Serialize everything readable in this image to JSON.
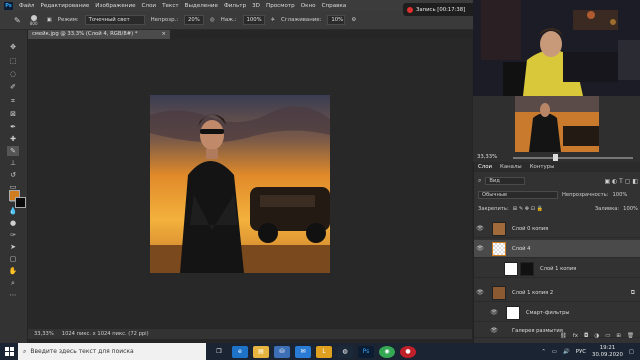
{
  "app": {
    "logo_text": "Ps"
  },
  "menubar": {
    "items": [
      "Файл",
      "Редактирование",
      "Изображение",
      "Слои",
      "Текст",
      "Выделение",
      "Фильтр",
      "3D",
      "Просмотр",
      "Окно",
      "Справка"
    ]
  },
  "options_bar": {
    "brush_size": "800",
    "mode_label": "Режим:",
    "mode_value": "Точечный свет",
    "opacity_label": "Непрозр.:",
    "opacity_value": "20%",
    "flow_label": "Наж.:",
    "flow_value": "100%",
    "smoothing_label": "Сглаживание:",
    "smoothing_value": "10%"
  },
  "recording": {
    "text": "Запись [00:17:38]"
  },
  "document": {
    "tab_title": "смейк.jpg @ 33,3% (Слой 4, RGB/8#) *",
    "close_symbol": "×",
    "status_zoom": "33,33%",
    "status_info": "1024 пикс. x 1024 пикс. (72 ppi)"
  },
  "colors": {
    "foreground": "#d07d1f",
    "background": "#0b0b0b",
    "accent": "#31a8ff"
  },
  "navigator": {
    "zoom": "33,33%"
  },
  "layers_panel": {
    "tabs": [
      "Слои",
      "Каналы",
      "Контуры"
    ],
    "active_tab": "Слои",
    "filter_label": "Вид",
    "blend_mode": "Обычные",
    "opacity_label": "Непрозрачность:",
    "opacity_value": "100%",
    "lock_label": "Закрепить:",
    "fill_label": "Заливка:",
    "fill_value": "100%",
    "layers": [
      {
        "name": "Слой 0 копия",
        "visible": true,
        "selected": false
      },
      {
        "name": "Слой 4",
        "visible": true,
        "selected": true
      },
      {
        "name": "Слой 1 копия",
        "visible": false,
        "selected": false
      },
      {
        "name": "Слой 1 копия 2",
        "visible": true,
        "selected": false
      },
      {
        "name": "Смарт-фильтры",
        "visible": true,
        "selected": false
      },
      {
        "name": "Галерея размытия",
        "visible": true,
        "selected": false
      }
    ]
  },
  "taskbar": {
    "search_placeholder": "Введите здесь текст для поиска",
    "language": "РУС",
    "time": "19:21",
    "date": "30.09.2020"
  }
}
